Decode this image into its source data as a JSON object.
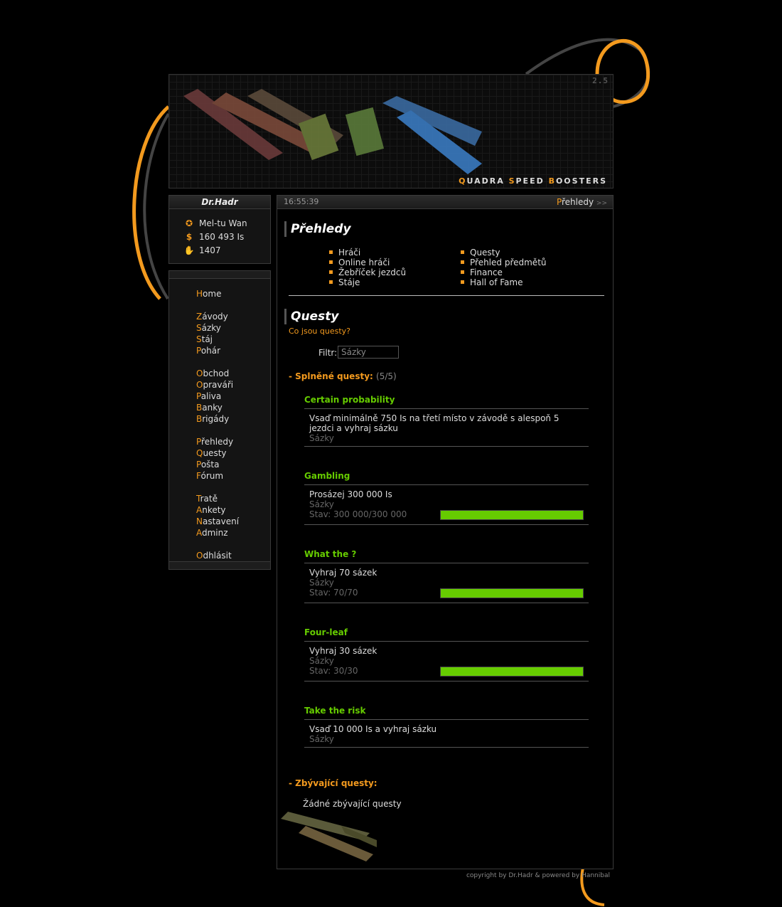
{
  "banner": {
    "version": "2.5",
    "logo_parts": [
      "Q",
      "UADRA ",
      "S",
      "PEED ",
      "B",
      "OOSTERS"
    ]
  },
  "user": {
    "name": "Dr.Hadr",
    "stable": "Mel-tu Wan",
    "money": "160 493 Is",
    "points": "1407",
    "icons": [
      "fighter-icon",
      "dollar-icon",
      "hand-icon"
    ]
  },
  "menu": [
    {
      "f": "H",
      "rest": "ome"
    },
    {
      "f": "Z",
      "rest": "ávody"
    },
    {
      "f": "S",
      "rest": "ázky"
    },
    {
      "f": "S",
      "rest": "táj"
    },
    {
      "f": "P",
      "rest": "ohár"
    },
    {
      "f": "O",
      "rest": "bchod"
    },
    {
      "f": "O",
      "rest": "praváři"
    },
    {
      "f": "P",
      "rest": "aliva"
    },
    {
      "f": "B",
      "rest": "anky"
    },
    {
      "f": "B",
      "rest": "rigády"
    },
    {
      "f": "P",
      "rest": "řehledy"
    },
    {
      "f": "Q",
      "rest": "uesty"
    },
    {
      "f": "P",
      "rest": "ošta"
    },
    {
      "f": "F",
      "rest": "órum"
    },
    {
      "f": "T",
      "rest": "ratě"
    },
    {
      "f": "A",
      "rest": "nkety"
    },
    {
      "f": "N",
      "rest": "astavení"
    },
    {
      "f": "A",
      "rest": "dminz"
    },
    {
      "f": "O",
      "rest": "dhlásit"
    }
  ],
  "topbar": {
    "time": "16:55:39",
    "crumb_first": "P",
    "crumb_rest": "řehledy",
    "crumb_arrow": ">>"
  },
  "overview": {
    "title": "Přehledy",
    "left": [
      "Hráči",
      "Online hráči",
      "Žebříček jezdců",
      "Stáje"
    ],
    "right": [
      "Questy",
      "Přehled předmětů",
      "Finance",
      "Hall of Fame"
    ]
  },
  "quests": {
    "title": "Questy",
    "help_link": "Co jsou questy?",
    "filter_label": "Filtr:",
    "filter_value": "Sázky",
    "completed_label": "- Splněné questy:",
    "completed_count": "(5/5)",
    "completed": [
      {
        "name": "Certain probability",
        "text": "Vsaď minimálně 750 Is na třetí místo v závodě s alespoň 5 jezdci a vyhraj sázku",
        "category": "Sázky",
        "state": "",
        "progress": null
      },
      {
        "name": "Gambling",
        "text": "Prosázej 300 000 Is",
        "category": "Sázky",
        "state": "Stav: 300 000/300 000",
        "progress": 1.0
      },
      {
        "name": "What the ?",
        "text": "Vyhraj 70 sázek",
        "category": "Sázky",
        "state": "Stav: 70/70",
        "progress": 1.0
      },
      {
        "name": "Four-leaf",
        "text": "Vyhraj 30 sázek",
        "category": "Sázky",
        "state": "Stav: 30/30",
        "progress": 1.0
      },
      {
        "name": "Take the risk",
        "text": "Vsaď 10 000 Is a vyhraj sázku",
        "category": "Sázky",
        "state": "",
        "progress": null
      }
    ],
    "remaining_label": "- Zbývající questy:",
    "remaining_none": "Žádné zbývající questy"
  },
  "footer": "copyright by Dr.Hadr & powered by Hannibal",
  "colors": {
    "accent": "#f39a1e",
    "quest_green": "#66cc00",
    "background": "#000000"
  }
}
